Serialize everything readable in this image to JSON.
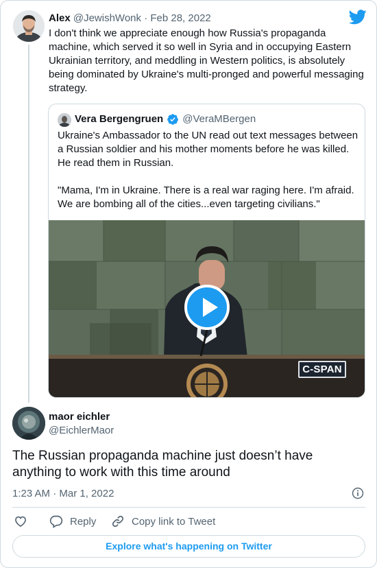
{
  "parent_tweet": {
    "name": "Alex",
    "handle": "@JewishWonk",
    "separator": "·",
    "date": "Feb 28, 2022",
    "text": "I don't think we appreciate enough how Russia's propaganda machine, which served it so well in Syria and in occupying Eastern Ukrainian territory, and meddling in Western politics, is absolutely being dominated by Ukraine's multi-pronged and powerful messaging strategy."
  },
  "quoted_tweet": {
    "name": "Vera Bergengruen",
    "handle": "@VeraMBergen",
    "paragraph_1": "Ukraine's Ambassador to the UN read out text messages between a Russian soldier and his mother moments before he was killed. He read them in Russian.",
    "paragraph_2": "\"Mama, I'm in Ukraine. There is a real war raging here. I'm afraid. We are bombing all of the cities...even targeting civilians.\"",
    "video_watermark": "C-SPAN"
  },
  "main_tweet": {
    "name": "maor eichler",
    "handle": "@EichlerMaor",
    "text": "The Russian propaganda machine just doesn’t have anything to work with this time around",
    "timestamp": "1:23 AM · Mar 1, 2022"
  },
  "actions": {
    "like_label": "",
    "reply_label": "Reply",
    "copy_link_label": "Copy link to Tweet"
  },
  "explore_label": "Explore what's happening on Twitter",
  "icons": [
    "twitter-bird-icon",
    "verified-badge-icon",
    "play-icon",
    "info-icon",
    "heart-icon",
    "reply-icon",
    "link-icon"
  ],
  "colors": {
    "accent": "#1d9bf0",
    "text": "#0f1419",
    "muted": "#536471",
    "border": "#cfd9de"
  }
}
